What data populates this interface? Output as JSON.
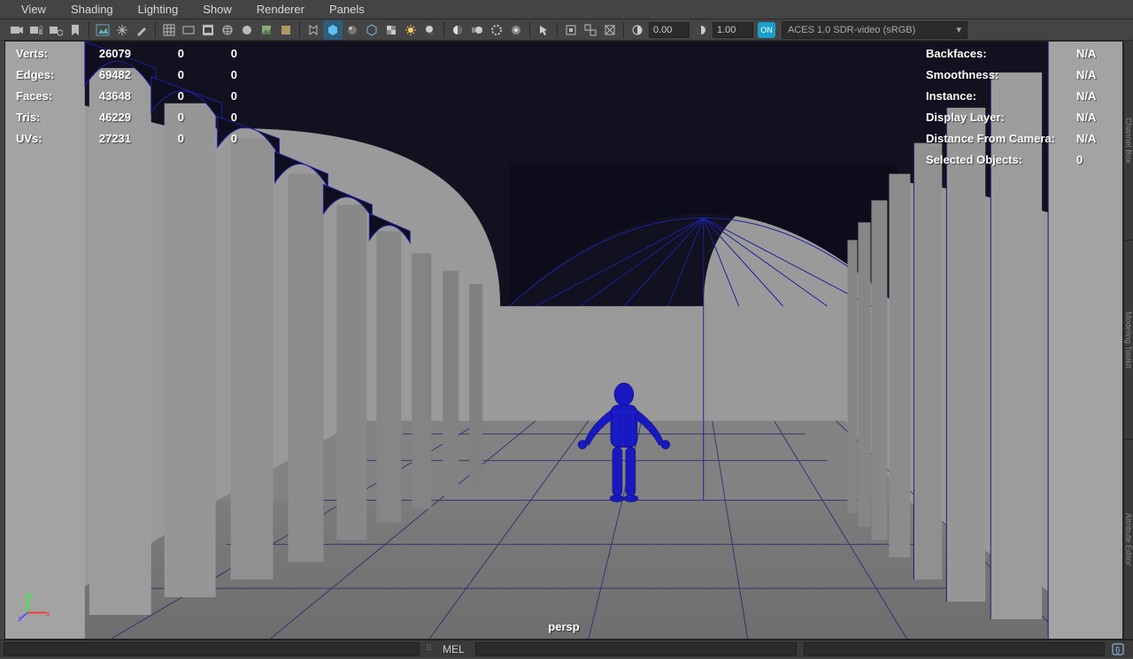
{
  "menus": [
    "View",
    "Shading",
    "Lighting",
    "Show",
    "Renderer",
    "Panels"
  ],
  "toolbar": {
    "field_a": "0.00",
    "field_b": "1.00",
    "on_label": "ON",
    "color_space": "ACES 1.0 SDR-video (sRGB)"
  },
  "hud_left_headers": [
    "Verts:",
    "Edges:",
    "Faces:",
    "Tris:",
    "UVs:"
  ],
  "hud_left": [
    {
      "label": "Verts:",
      "v1": "26079",
      "v2": "0",
      "v3": "0"
    },
    {
      "label": "Edges:",
      "v1": "69482",
      "v2": "0",
      "v3": "0"
    },
    {
      "label": "Faces:",
      "v1": "43648",
      "v2": "0",
      "v3": "0"
    },
    {
      "label": "Tris:",
      "v1": "46229",
      "v2": "0",
      "v3": "0"
    },
    {
      "label": "UVs:",
      "v1": "27231",
      "v2": "0",
      "v3": "0"
    }
  ],
  "hud_right": [
    {
      "label": "Backfaces:",
      "val": "N/A"
    },
    {
      "label": "Smoothness:",
      "val": "N/A"
    },
    {
      "label": "Instance:",
      "val": "N/A"
    },
    {
      "label": "Display Layer:",
      "val": "N/A"
    },
    {
      "label": "Distance From Camera:",
      "val": "N/A"
    },
    {
      "label": "Selected Objects:",
      "val": "0"
    }
  ],
  "camera": "persp",
  "bottom": {
    "script_lang": "MEL"
  },
  "axis": {
    "x": "x",
    "y": "y",
    "z": "z"
  },
  "right_tabs": [
    "Channel Box",
    "Modeling Toolkit",
    "Attribute Editor"
  ]
}
